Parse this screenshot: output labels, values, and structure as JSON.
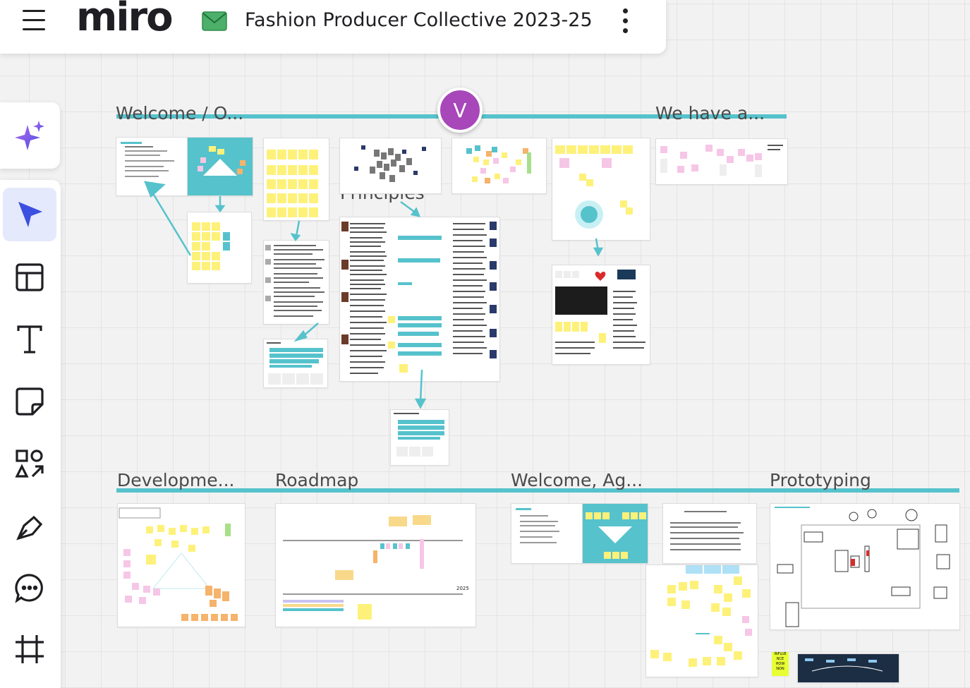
{
  "app": {
    "logo": "miro"
  },
  "board": {
    "title": "Fashion Producer Collective 2023-25"
  },
  "header": {
    "menu_icon": "hamburger-icon",
    "board_icon": "envelope-icon",
    "more_icon": "more-vertical-icon"
  },
  "toolbar": {
    "ai_icon": "sparkles-icon",
    "tools": [
      {
        "name": "select",
        "icon": "cursor-icon",
        "active": true
      },
      {
        "name": "templates",
        "icon": "layout-icon",
        "active": false
      },
      {
        "name": "text",
        "icon": "text-icon",
        "active": false
      },
      {
        "name": "sticky-note",
        "icon": "sticky-note-icon",
        "active": false
      },
      {
        "name": "shapes",
        "icon": "shapes-icon",
        "active": false
      },
      {
        "name": "pen",
        "icon": "pen-icon",
        "active": false
      },
      {
        "name": "comment",
        "icon": "comment-icon",
        "active": false
      },
      {
        "name": "frame",
        "icon": "frame-icon",
        "active": false
      }
    ]
  },
  "collaborator": {
    "initial": "V",
    "color": "#a747b9"
  },
  "frames": {
    "welcome_o": "Welcome / O...",
    "we_have_a": "We have a...",
    "principles": "Principles",
    "development": "Developme...",
    "roadmap": "Roadmap",
    "welcome_ag": "Welcome, Ag...",
    "prototyping": "Prototyping"
  },
  "roadmap": {
    "year_label": "2025"
  },
  "prototype": {
    "influence_note": "INFLUE NCE HOW NON"
  },
  "colors": {
    "accent_line": "#56c2cc",
    "sticky_yellow": "#fdf17a",
    "sticky_teal": "#56c2cc",
    "sticky_pink": "#f6c6e6",
    "sticky_orange": "#f5b36b",
    "active_tool_bg": "#e4e9fb",
    "cursor_blue": "#3b4fe0"
  }
}
